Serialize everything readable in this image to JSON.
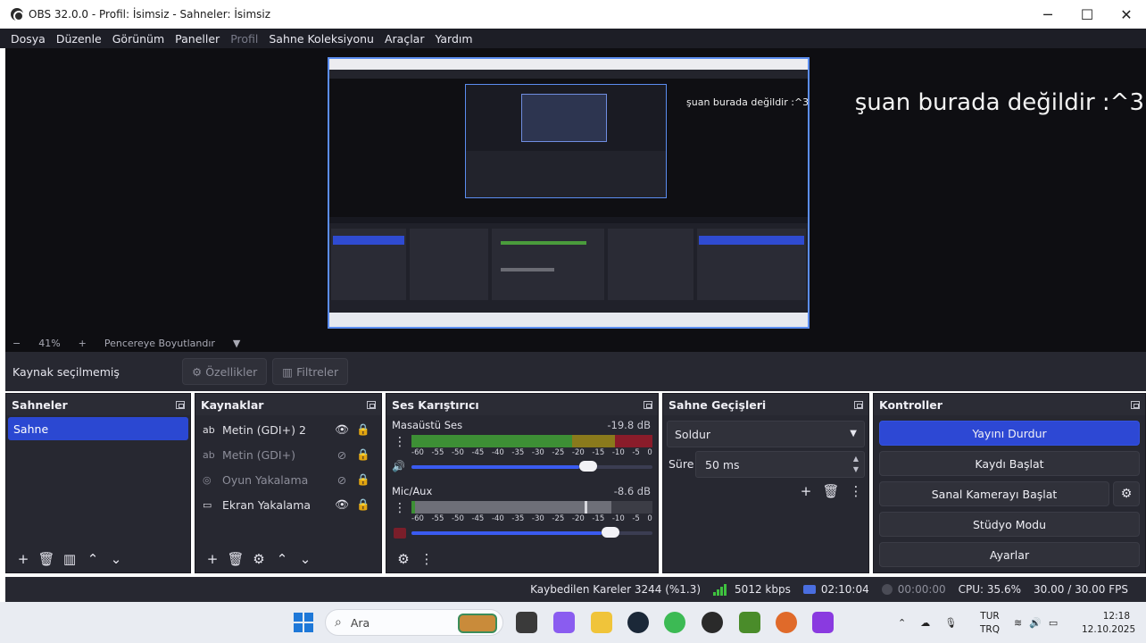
{
  "window": {
    "title": "OBS 32.0.0 - Profil: İsimsiz - Sahneler: İsimsiz",
    "controls": {
      "minimize": "─",
      "maximize": "☐",
      "close": "✕"
    }
  },
  "menu": {
    "items": [
      "Dosya",
      "Düzenle",
      "Görünüm",
      "Paneller",
      "Profil",
      "Sahne Koleksiyonu",
      "Araçlar",
      "Yardım"
    ]
  },
  "preview": {
    "overlay_text": "şuan burada değildir :^3",
    "nested_text": "şuan burada değildir :^3",
    "zoom_minus": "−",
    "zoom_value": "41%",
    "zoom_plus": "+",
    "fit_label": "Pencereye Boyutlandır"
  },
  "source_toolbar": {
    "no_selection": "Kaynak seçilmemiş",
    "properties": "Özellikler",
    "filters": "Filtreler"
  },
  "scenes": {
    "title": "Sahneler",
    "items": [
      "Sahne"
    ]
  },
  "sources": {
    "title": "Kaynaklar",
    "items": [
      {
        "name": "Metin (GDI+) 2",
        "icon": "text-icon",
        "visible": true
      },
      {
        "name": "Metin (GDI+)",
        "icon": "text-icon",
        "visible": false
      },
      {
        "name": "Oyun Yakalama",
        "icon": "gamepad-icon",
        "visible": false
      },
      {
        "name": "Ekran Yakalama",
        "icon": "monitor-icon",
        "visible": true
      }
    ]
  },
  "mixer": {
    "title": "Ses Karıştırıcı",
    "channels": [
      {
        "name": "Masaüstü Ses",
        "db": "-19.8 dB",
        "volume_fraction": 0.75
      },
      {
        "name": "Mic/Aux",
        "db": "-8.6 dB",
        "volume_fraction": 0.85
      }
    ],
    "scale": [
      "-60",
      "-55",
      "-50",
      "-45",
      "-40",
      "-35",
      "-30",
      "-25",
      "-20",
      "-15",
      "-10",
      "-5",
      "0"
    ]
  },
  "transitions": {
    "title": "Sahne Geçişleri",
    "selected": "Soldur",
    "duration_label": "Süre",
    "duration_value": "50 ms"
  },
  "controls": {
    "title": "Kontroller",
    "stop_stream": "Yayını Durdur",
    "start_recording": "Kaydı Başlat",
    "start_virtual_cam": "Sanal Kamerayı Başlat",
    "studio_mode": "Stüdyo Modu",
    "settings": "Ayarlar"
  },
  "status": {
    "dropped_frames": "Kaybedilen Kareler 3244 (%1.3)",
    "bitrate": "5012 kbps",
    "stream_time": "02:10:04",
    "rec_time": "00:00:00",
    "cpu": "CPU: 35.6%",
    "fps": "30.00 / 30.00 FPS"
  },
  "taskbar": {
    "search_placeholder": "Ara",
    "lang_top": "TUR",
    "lang_bottom": "TRQ",
    "time": "12:18",
    "date": "12.10.2025"
  },
  "colors": {
    "accent": "#2d48d4",
    "panel": "#272831",
    "meter_green": "#3d8f35",
    "meter_yellow": "#8a7a1c",
    "meter_red": "#8a1c2a"
  }
}
